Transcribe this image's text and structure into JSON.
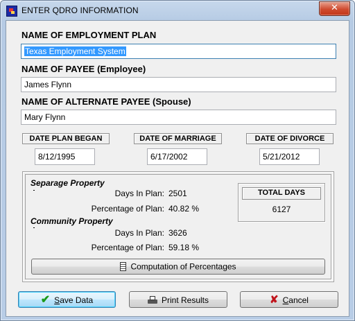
{
  "window": {
    "title": "ENTER QDRO INFORMATION",
    "close_glyph": "✕"
  },
  "plan": {
    "label": "NAME OF EMPLOYMENT PLAN",
    "value": "Texas Employment System"
  },
  "payee": {
    "label": "NAME OF PAYEE (Employee)",
    "value": "James Flynn"
  },
  "alt_payee": {
    "label": "NAME OF ALTERNATE PAYEE (Spouse)",
    "value": "Mary Flynn"
  },
  "dates": {
    "plan_began": {
      "label": "DATE PLAN BEGAN",
      "value": "8/12/1995"
    },
    "marriage": {
      "label": "DATE OF MARRIAGE",
      "value": "6/17/2002"
    },
    "divorce": {
      "label": "DATE OF DIVORCE",
      "value": "5/21/2012"
    }
  },
  "separate": {
    "title": "Separage Property",
    "days_label": "Days In Plan:",
    "days_value": "2501",
    "pct_label": "Percentage of Plan:",
    "pct_value": "40.82 %"
  },
  "community": {
    "title": "Community Property",
    "days_label": "Days In Plan:",
    "days_value": "3626",
    "pct_label": "Percentage of Plan:",
    "pct_value": "59.18 %"
  },
  "total": {
    "label": "TOTAL DAYS",
    "value": "6127"
  },
  "buttons": {
    "compute": "Computation of Percentages",
    "save_first": "S",
    "save_rest": "ave Data",
    "print": "Print Results",
    "cancel_first": "C",
    "cancel_rest": "ancel"
  },
  "icons": {
    "save": "checkmark-icon",
    "print": "printer-icon",
    "cancel": "x-icon",
    "compute": "calculator-icon"
  },
  "colors": {
    "selection": "#3399ff",
    "save_check": "#1a9a1a",
    "cancel_x": "#c0141c"
  }
}
